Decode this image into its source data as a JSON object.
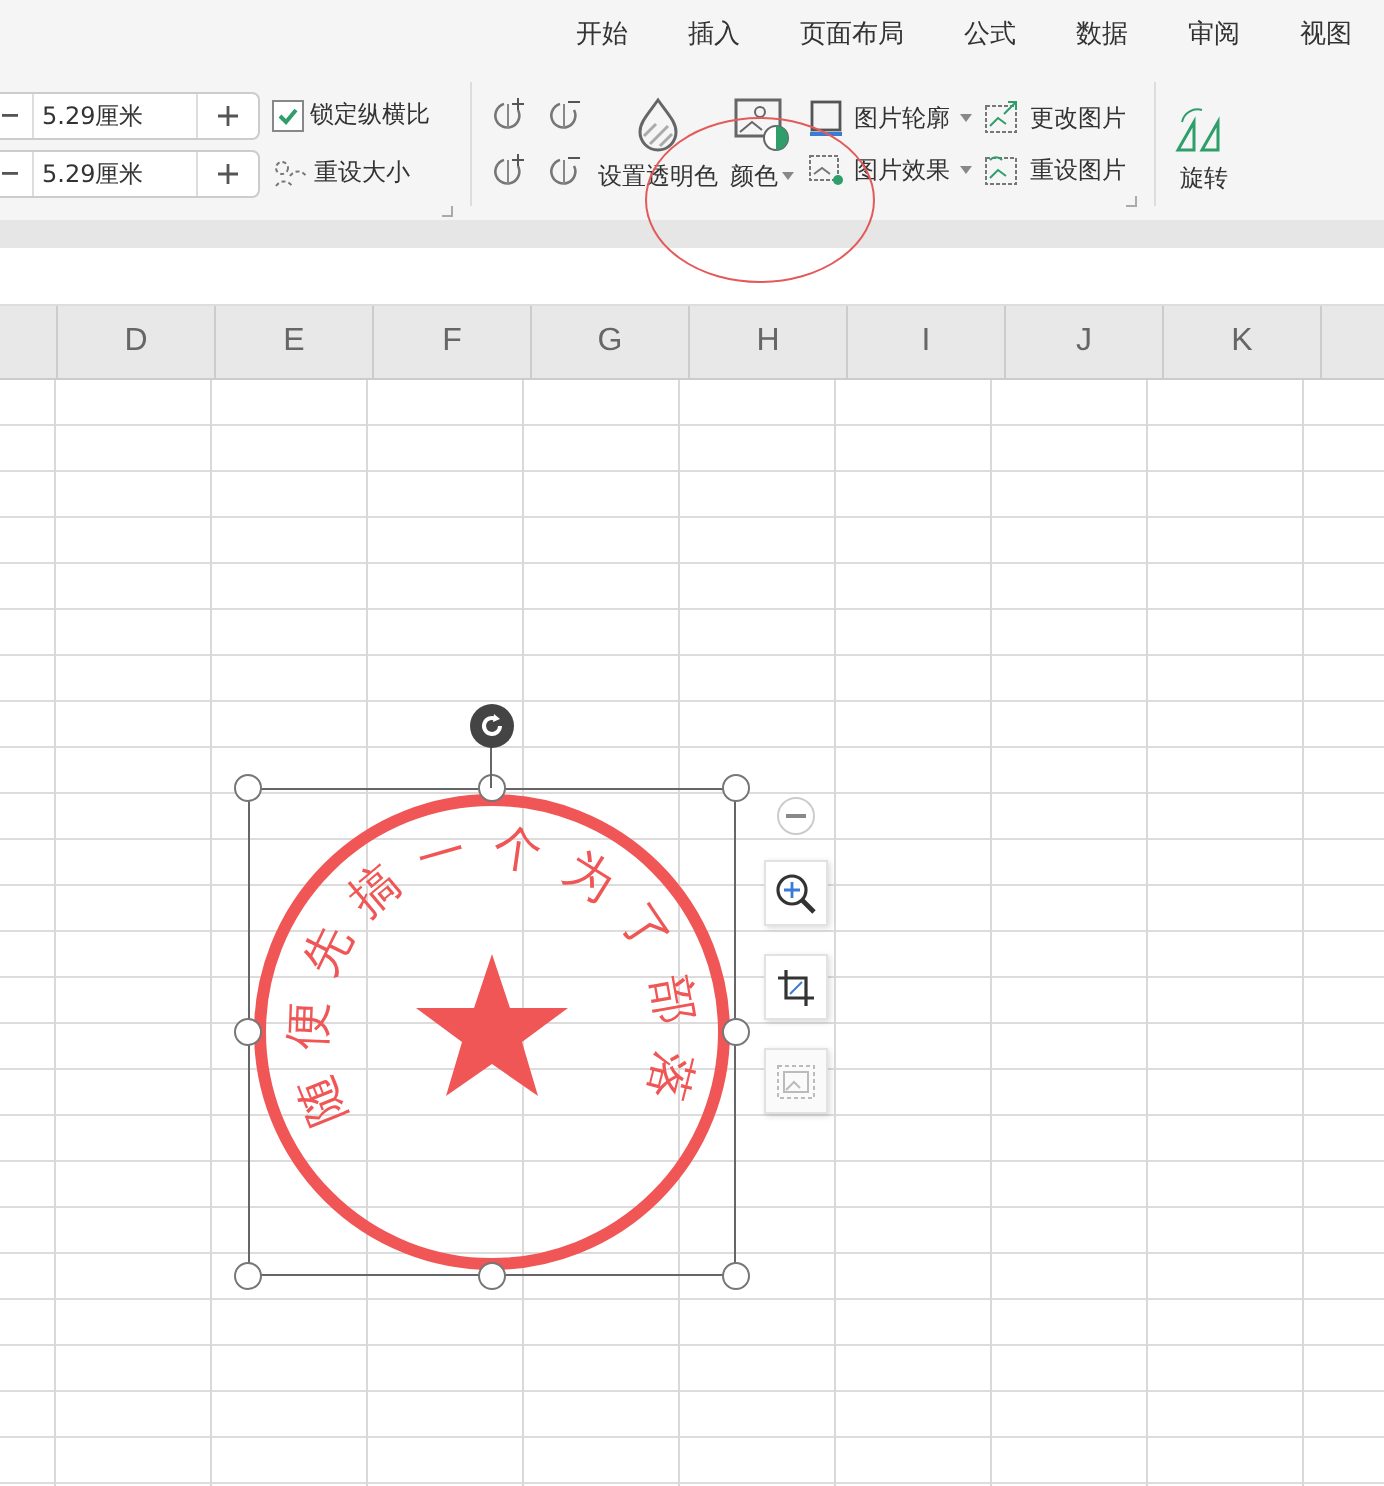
{
  "tabs": [
    {
      "label": "开始"
    },
    {
      "label": "插入"
    },
    {
      "label": "页面布局"
    },
    {
      "label": "公式"
    },
    {
      "label": "数据"
    },
    {
      "label": "审阅"
    },
    {
      "label": "视图"
    }
  ],
  "size_fields": [
    {
      "value": "5.29厘米"
    },
    {
      "value": "5.29厘米"
    }
  ],
  "lock_ratio": {
    "label": "锁定纵横比",
    "checked": true
  },
  "reset_size": {
    "label": "重设大小"
  },
  "set_transparent": {
    "label": "设置透明色"
  },
  "color": {
    "label": "颜色"
  },
  "picture_tools": [
    {
      "label": "图片轮廓",
      "dropdown": true,
      "kind": "outline"
    },
    {
      "label": "更改图片",
      "dropdown": false,
      "kind": "change"
    },
    {
      "label": "图片效果",
      "dropdown": true,
      "kind": "effect"
    },
    {
      "label": "重设图片",
      "dropdown": false,
      "kind": "reset"
    }
  ],
  "rotate": {
    "label": "旋转"
  },
  "columns": [
    "D",
    "E",
    "F",
    "G",
    "H",
    "I",
    "J",
    "K"
  ],
  "picture": {
    "stamp_text": "随便先搞一个为了部落"
  },
  "side_tools": [
    {
      "kind": "collapse",
      "disabled": false
    },
    {
      "kind": "zoom",
      "disabled": false
    },
    {
      "kind": "crop",
      "disabled": false
    },
    {
      "kind": "image",
      "disabled": true
    }
  ]
}
